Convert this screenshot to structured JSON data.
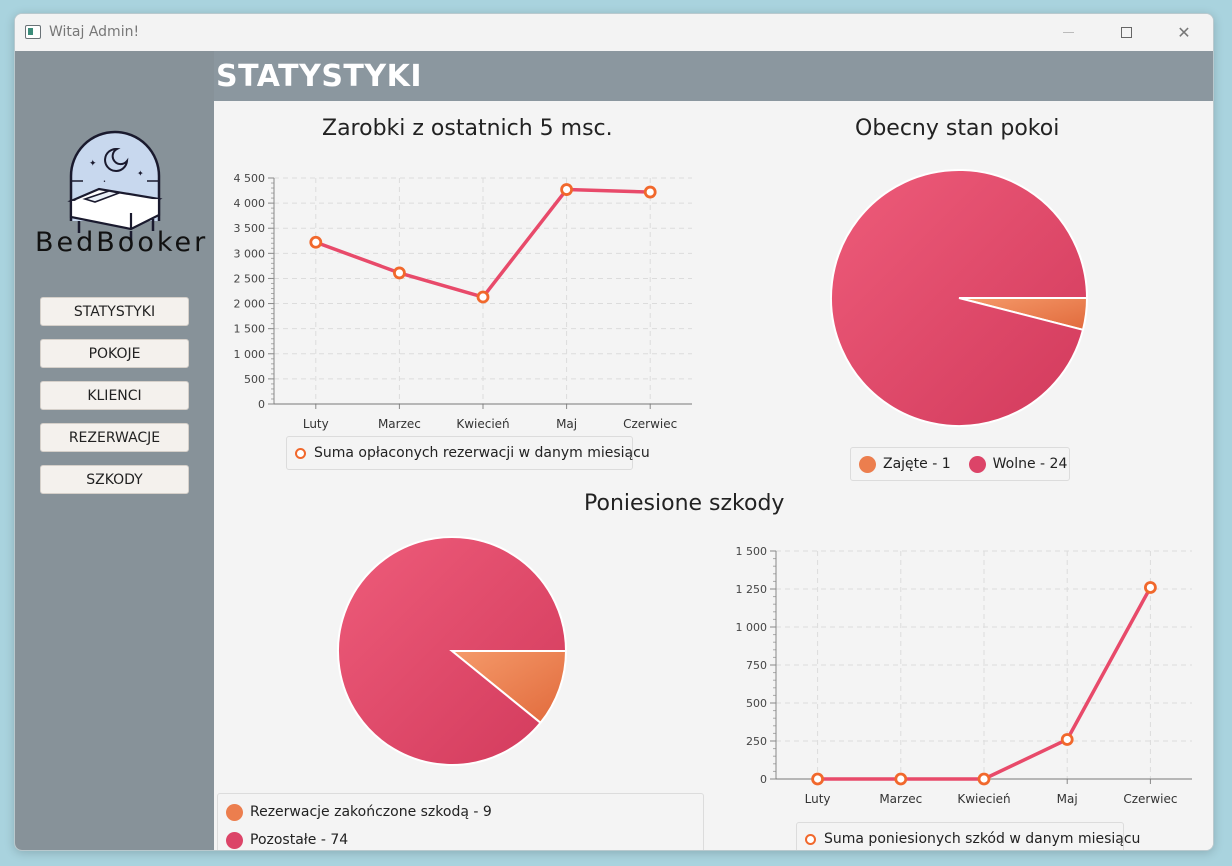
{
  "window": {
    "title": "Witaj Admin!"
  },
  "header": {
    "title": "STATYSTYKI"
  },
  "sidebar": {
    "brand": "BedBooker",
    "nav": [
      {
        "label": "STATYSTYKI"
      },
      {
        "label": "POKOJE"
      },
      {
        "label": "KLIENCI"
      },
      {
        "label": "REZERWACJE"
      },
      {
        "label": "SZKODY"
      }
    ]
  },
  "colors": {
    "line": "#e84a6a",
    "marker": "#f1682c",
    "pie_main": "#dc4468",
    "pie_slice": "#ec7e4e",
    "sidebar": "#879299",
    "header": "#8b979f"
  },
  "chart_data": [
    {
      "type": "line",
      "title": "Zarobki z ostatnich 5 msc.",
      "categories": [
        "Luty",
        "Marzec",
        "Kwiecień",
        "Maj",
        "Czerwiec"
      ],
      "series": [
        {
          "name": "Suma opłaconych rezerwacji w danym miesiącu",
          "values": [
            3220,
            2610,
            2130,
            4270,
            4220
          ]
        }
      ],
      "yticks": [
        "0",
        "500",
        "1 000",
        "1 500",
        "2 000",
        "2 500",
        "3 000",
        "3 500",
        "4 000",
        "4 500"
      ],
      "ylim": [
        0,
        4500
      ],
      "grid": true,
      "legend_position": "bottom"
    },
    {
      "type": "pie",
      "title": "Obecny stan pokoi",
      "slices": [
        {
          "label": "Zajęte - 1",
          "value": 1
        },
        {
          "label": "Wolne - 24",
          "value": 24
        }
      ],
      "legend_position": "bottom"
    },
    {
      "type": "pie",
      "title": "Poniesione  szkody",
      "slices": [
        {
          "label": "Rezerwacje zakończone szkodą - 9",
          "value": 9
        },
        {
          "label": "Pozostałe - 74",
          "value": 74
        }
      ],
      "legend_position": "bottom"
    },
    {
      "type": "line",
      "title": "",
      "categories": [
        "Luty",
        "Marzec",
        "Kwiecień",
        "Maj",
        "Czerwiec"
      ],
      "series": [
        {
          "name": "Suma poniesionych szkód w danym miesiącu",
          "values": [
            0,
            0,
            0,
            260,
            1260
          ]
        }
      ],
      "yticks": [
        "0",
        "250",
        "500",
        "750",
        "1 000",
        "1 250",
        "1 500"
      ],
      "ylim": [
        0,
        1500
      ],
      "grid": true,
      "legend_position": "bottom"
    }
  ]
}
